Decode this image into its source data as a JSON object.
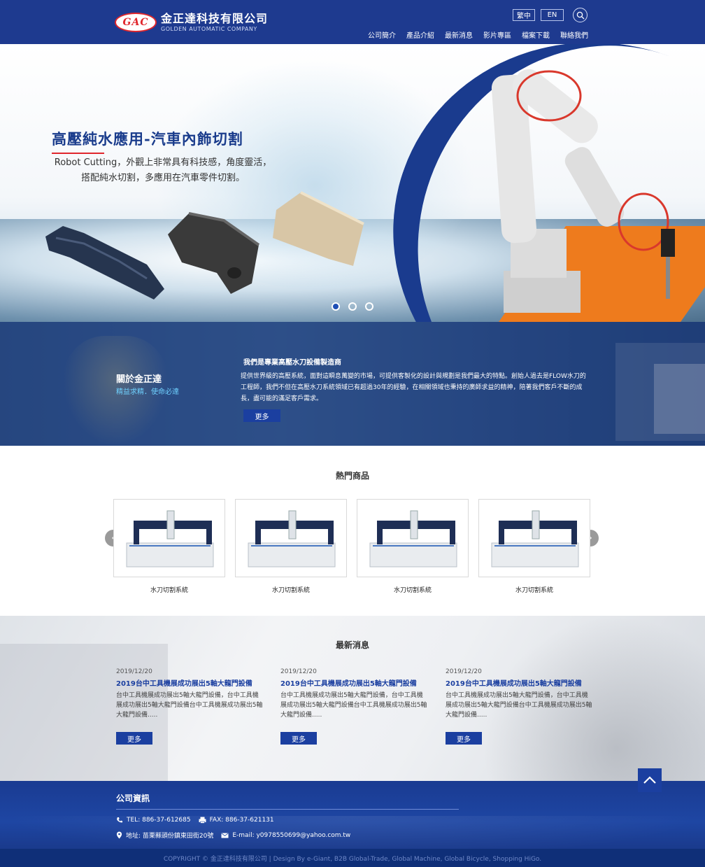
{
  "header": {
    "logo_mark": "GAC",
    "company_name": "金正達科技有限公司",
    "company_name_en": "GOLDEN AUTOMATIC COMPANY",
    "lang": [
      "繁中",
      "EN"
    ],
    "nav": [
      "公司簡介",
      "產品介紹",
      "最新消息",
      "影片專區",
      "檔案下載",
      "聯絡我們"
    ]
  },
  "hero": {
    "title": "高壓純水應用-汽車內飾切割",
    "description": "Robot Cutting，外觀上非常具有科技感，角度靈活，搭配純水切割，多應用在汽車零件切割。",
    "slides": 3,
    "active_slide": 1
  },
  "about": {
    "title": "關於金正達",
    "subtitle": "精益求精．使命必達",
    "heading": "我們是專業高壓水刀設備製造商",
    "body": "提供世界級的高壓系統，面對這瞬息萬變的市場，可提供客製化的設計與規劃是我們最大的特點。創始人過去是FLOW水刀的工程師，我們不但在高壓水刀系統領域已有超過30年的經驗，在相關領域也秉持的廣師求益的精神，陪著我們客戶不斷的成長，盡可能的滿足客戶需求。",
    "more": "更多"
  },
  "hot_products": {
    "title": "熱門商品",
    "items": [
      {
        "name": "水刀切割系統"
      },
      {
        "name": "水刀切割系統"
      },
      {
        "name": "水刀切割系統"
      },
      {
        "name": "水刀切割系統"
      }
    ]
  },
  "news": {
    "title": "最新消息",
    "items": [
      {
        "date": "2019/12/20",
        "headline": "2019台中工具機展成功展出5軸大龍門設備",
        "summary": "台中工具機展成功展出5軸大龍門設備，台中工具機展成功展出5軸大龍門設備台中工具機展成功展出5軸大龍門設備.....",
        "more": "更多"
      },
      {
        "date": "2019/12/20",
        "headline": "2019台中工具機展成功展出5軸大龍門設備",
        "summary": "台中工具機展成功展出5軸大龍門設備，台中工具機展成功展出5軸大龍門設備台中工具機展成功展出5軸大龍門設備.....",
        "more": "更多"
      },
      {
        "date": "2019/12/20",
        "headline": "2019台中工具機展成功展出5軸大龍門設備",
        "summary": "台中工具機展成功展出5軸大龍門設備，台中工具機展成功展出5軸大龍門設備台中工具機展成功展出5軸大龍門設備.....",
        "more": "更多"
      }
    ]
  },
  "footer": {
    "title": "公司資訊",
    "tel": "TEL: 886-37-612685",
    "fax": "FAX: 886-37-621131",
    "address": "地址: 苗栗縣頭份鎮東田街20號",
    "email": "E-mail: y0978550699@yahoo.com.tw",
    "copyright": "COPYRIGHT © 金正達科技有限公司 | Design By  e-Giant, B2B Global-Trade, Global Machine, Global Bicycle, Shopping HiGo."
  },
  "colors": {
    "brand_blue": "#1e3a8f",
    "accent_red": "#e0262c",
    "accent_orange": "#ee7b1d",
    "link_blue": "#1b3fa0"
  },
  "icons": [
    "search-icon",
    "phone-icon",
    "fax-icon",
    "location-icon",
    "mail-icon",
    "chevron-up-icon",
    "chevron-left-icon",
    "chevron-right-icon"
  ]
}
